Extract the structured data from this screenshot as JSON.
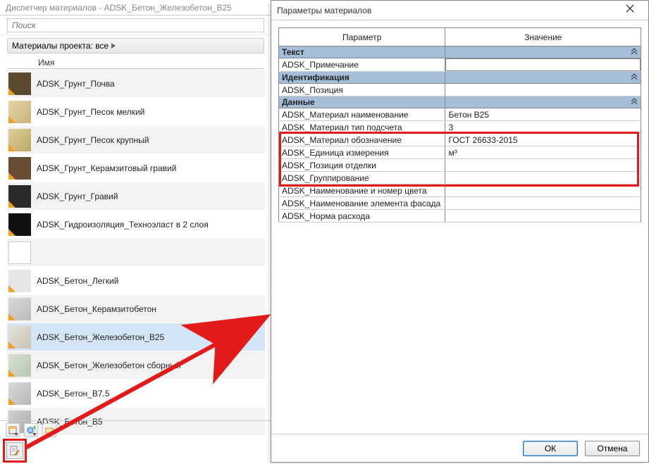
{
  "back": {
    "title": "Диспетчер материалов - ADSK_Бетон_Железобетон_В25",
    "search_placeholder": "Поиск",
    "filter_label": "Материалы проекта: все",
    "name_header": "Имя",
    "materials": [
      {
        "label": "ADSK_Грунт_Почва",
        "cls": "t-soil"
      },
      {
        "label": "ADSK_Грунт_Песок мелкий",
        "cls": "t-sand"
      },
      {
        "label": "ADSK_Грунт_Песок крупный",
        "cls": "t-sandc"
      },
      {
        "label": "ADSK_Грунт_Керамзитовый гравий",
        "cls": "t-keram"
      },
      {
        "label": "ADSK_Грунт_Гравий",
        "cls": "t-gravel"
      },
      {
        "label": "ADSK_Гидроизоляция_Техноэласт в 2 слоя",
        "cls": "t-hydro"
      },
      {
        "label": "",
        "cls": "t-blank"
      },
      {
        "label": "ADSK_Бетон_Легкий",
        "cls": "t-light"
      },
      {
        "label": "ADSK_Бетон_Керамзитобетон",
        "cls": "t-kerbet"
      },
      {
        "label": "ADSK_Бетон_Железобетон_В25",
        "cls": "t-b25"
      },
      {
        "label": "ADSK_Бетон_Железобетон сборный",
        "cls": "t-precast"
      },
      {
        "label": "ADSK_Бетон_В7.5",
        "cls": "t-b75"
      },
      {
        "label": "ADSK_Бетон_В5",
        "cls": "t-b5"
      }
    ],
    "selected_index": 9
  },
  "dlg": {
    "title": "Параметры материалов",
    "col_param": "Параметр",
    "col_value": "Значение",
    "sections": [
      {
        "title": "Текст",
        "rows": [
          {
            "p": "ADSK_Примечание",
            "v": "",
            "editing": true
          }
        ]
      },
      {
        "title": "Идентификация",
        "rows": [
          {
            "p": "ADSK_Позиция",
            "v": ""
          }
        ]
      },
      {
        "title": "Данные",
        "rows": [
          {
            "p": "ADSK_Материал наименование",
            "v": "Бетон В25"
          },
          {
            "p": "ADSK_Материал тип подсчета",
            "v": "3"
          },
          {
            "p": "ADSK_Материал обозначение",
            "v": "ГОСТ 26633-2015"
          },
          {
            "p": "ADSK_Единица измерения",
            "v": "м³"
          },
          {
            "p": "ADSK_Позиция отделки",
            "v": ""
          },
          {
            "p": "ADSK_Группирование",
            "v": ""
          },
          {
            "p": "ADSK_Наименование и номер цвета",
            "v": ""
          },
          {
            "p": "ADSK_Наименование элемента фасада",
            "v": ""
          },
          {
            "p": "ADSK_Норма расхода",
            "v": ""
          }
        ]
      }
    ],
    "ok": "ОК",
    "cancel": "Отмена"
  }
}
